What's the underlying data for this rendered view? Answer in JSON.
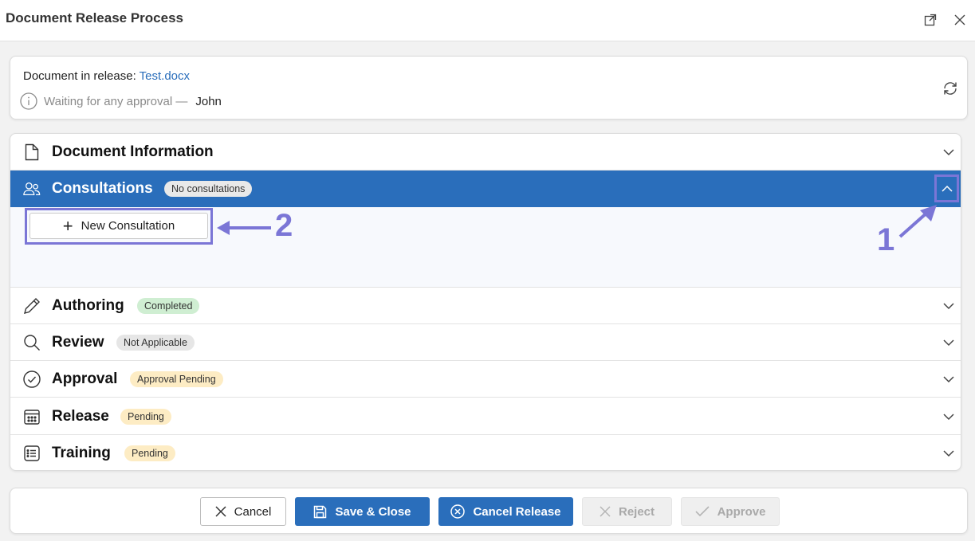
{
  "window": {
    "title": "Document Release Process"
  },
  "info": {
    "doc_prefix": "Document in release:",
    "doc_name": "Test.docx",
    "status_text": "Waiting for any approval —",
    "user": "John"
  },
  "sections": [
    {
      "label": "Document Information",
      "badge": "",
      "icon": "document-icon"
    },
    {
      "label": "Consultations",
      "badge": "No consultations",
      "icon": "people-icon"
    },
    {
      "label": "Authoring",
      "badge": "Completed",
      "icon": "pencil-icon"
    },
    {
      "label": "Review",
      "badge": "Not Applicable",
      "icon": "search-icon"
    },
    {
      "label": "Approval",
      "badge": "Approval Pending",
      "icon": "check-circle-icon"
    },
    {
      "label": "Release",
      "badge": "Pending",
      "icon": "calendar-icon"
    },
    {
      "label": "Training",
      "badge": "Pending",
      "icon": "list-icon"
    }
  ],
  "consultations": {
    "new_button": "New Consultation"
  },
  "annotations": {
    "one": "1",
    "two": "2"
  },
  "footer": {
    "cancel": "Cancel",
    "save_close": "Save & Close",
    "cancel_release": "Cancel Release",
    "reject": "Reject",
    "approve": "Approve"
  },
  "colors": {
    "accent": "#2a6ebb",
    "annotation": "#7b76d6",
    "badge_completed": "#cfeed2",
    "badge_pending": "#fdecc4",
    "badge_neutral": "#e6e6e6"
  }
}
